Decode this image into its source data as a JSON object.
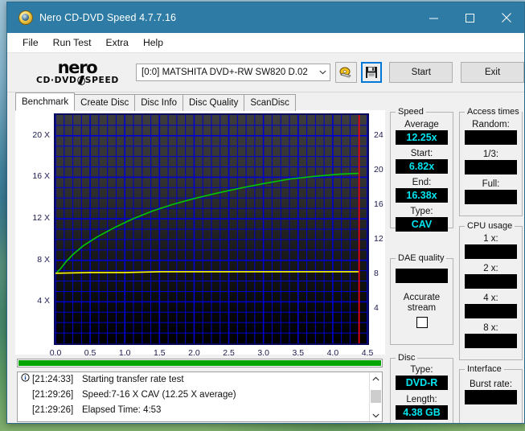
{
  "window": {
    "title": "Nero CD-DVD Speed 4.7.7.16",
    "icon": "nero-disc-icon",
    "controls": [
      {
        "name": "minimize-button",
        "glyph": "minimize-icon"
      },
      {
        "name": "maximize-button",
        "glyph": "maximize-icon"
      },
      {
        "name": "close-button",
        "glyph": "close-icon"
      }
    ]
  },
  "menubar": {
    "items": [
      {
        "label": "File",
        "name": "menu-file"
      },
      {
        "label": "Run Test",
        "name": "menu-run-test"
      },
      {
        "label": "Extra",
        "name": "menu-extra"
      },
      {
        "label": "Help",
        "name": "menu-help"
      }
    ]
  },
  "toolbar": {
    "logo_word": "nero",
    "logo_sub_left": "CD·DVD",
    "logo_sub_right": "SPEED",
    "drive_selected": "[0:0]   MATSHITA DVD+-RW SW820 D.02",
    "eject_icon": "eject-disc-icon",
    "save_icon": "floppy-save-icon",
    "start_label": "Start",
    "exit_label": "Exit"
  },
  "tabs": [
    {
      "label": "Benchmark",
      "active": true
    },
    {
      "label": "Create Disc",
      "active": false
    },
    {
      "label": "Disc Info",
      "active": false
    },
    {
      "label": "Disc Quality",
      "active": false
    },
    {
      "label": "ScanDisc",
      "active": false
    }
  ],
  "chart_data": {
    "type": "line",
    "title": "",
    "xlabel": "",
    "ylabel": "",
    "xlim": [
      0.0,
      4.5
    ],
    "ylim": [
      0,
      22
    ],
    "grid": true,
    "left_axis": {
      "name": "speed-x",
      "ticks": [
        4,
        8,
        12,
        16,
        20
      ],
      "tick_labels": [
        "4 X",
        "8 X",
        "12 X",
        "16 X",
        "20 X"
      ]
    },
    "right_axis": {
      "name": "access-scale",
      "ticks": [
        4,
        8,
        12,
        16,
        20,
        24
      ],
      "tick_labels": [
        "4",
        "8",
        "12",
        "16",
        "20",
        "24"
      ]
    },
    "x_axis": {
      "ticks": [
        0.0,
        0.5,
        1.0,
        1.5,
        2.0,
        2.5,
        3.0,
        3.5,
        4.0,
        4.5
      ],
      "tick_labels": [
        "0.0",
        "0.5",
        "1.0",
        "1.5",
        "2.0",
        "2.5",
        "3.0",
        "3.5",
        "4.0",
        "4.5"
      ]
    },
    "series": [
      {
        "name": "transfer-rate",
        "color": "#00c800",
        "x": [
          0.02,
          0.08,
          0.15,
          0.25,
          0.4,
          0.6,
          0.85,
          1.1,
          1.4,
          1.7,
          2.0,
          2.35,
          2.7,
          3.05,
          3.4,
          3.75,
          4.1,
          4.38
        ],
        "y": [
          6.82,
          7.25,
          7.85,
          8.55,
          9.4,
          10.25,
          11.15,
          11.95,
          12.75,
          13.4,
          13.95,
          14.5,
          15.0,
          15.45,
          15.85,
          16.1,
          16.3,
          16.38
        ]
      },
      {
        "name": "cpu-or-dae-line",
        "color": "#ffff00",
        "x": [
          0.0,
          0.5,
          1.0,
          1.5,
          2.0,
          2.5,
          3.0,
          3.5,
          4.0,
          4.38
        ],
        "y": [
          6.75,
          6.82,
          6.82,
          6.9,
          6.9,
          6.9,
          6.9,
          6.9,
          6.9,
          6.9
        ]
      }
    ],
    "markers": [
      {
        "name": "end-of-disc-marker",
        "color": "#ff0000",
        "x": 4.38,
        "orientation": "vertical"
      }
    ]
  },
  "speed_panel": {
    "legend": "Speed",
    "fields": [
      {
        "label": "Average",
        "value": "12.25x",
        "name": "speed-average"
      },
      {
        "label": "Start:",
        "value": "6.82x",
        "name": "speed-start"
      },
      {
        "label": "End:",
        "value": "16.38x",
        "name": "speed-end"
      },
      {
        "label": "Type:",
        "value": "CAV",
        "name": "speed-type"
      }
    ]
  },
  "dae_panel": {
    "legend": "DAE quality",
    "value": "",
    "checkbox_label_line1": "Accurate",
    "checkbox_label_line2": "stream",
    "checkbox_checked": false
  },
  "access_panel": {
    "legend": "Access times",
    "fields": [
      {
        "label": "Random:",
        "value": "",
        "name": "access-random"
      },
      {
        "label": "1/3:",
        "value": "",
        "name": "access-one-third"
      },
      {
        "label": "Full:",
        "value": "",
        "name": "access-full"
      }
    ]
  },
  "cpu_panel": {
    "legend": "CPU usage",
    "fields": [
      {
        "label": "1 x:",
        "value": "",
        "name": "cpu-1x"
      },
      {
        "label": "2 x:",
        "value": "",
        "name": "cpu-2x"
      },
      {
        "label": "4 x:",
        "value": "",
        "name": "cpu-4x"
      },
      {
        "label": "8 x:",
        "value": "",
        "name": "cpu-8x"
      }
    ]
  },
  "disc_panel": {
    "legend": "Disc",
    "type_label": "Type:",
    "type_value": "DVD-R",
    "length_label": "Length:",
    "length_value": "4.38 GB"
  },
  "interface_panel": {
    "legend": "Interface",
    "burst_label": "Burst rate:",
    "burst_value": ""
  },
  "progress": {
    "percent": 100,
    "color": "#00a500"
  },
  "log": {
    "lines": [
      {
        "icon": "info-icon",
        "time": "[21:24:33]",
        "text": "Starting transfer rate test"
      },
      {
        "icon": "",
        "time": "[21:29:26]",
        "text": "Speed:7-16 X CAV (12.25 X average)"
      },
      {
        "icon": "",
        "time": "[21:29:26]",
        "text": "Elapsed Time:  4:53"
      }
    ],
    "scroll_up": "▲",
    "scroll_down": "▼"
  },
  "colors": {
    "titlebar": "#2e7ca6",
    "accent_cyan": "#00e5ef",
    "green_series": "#00c800",
    "yellow_series": "#ffff00",
    "red_marker": "#ff0000",
    "grid_blue": "#0000d2"
  }
}
